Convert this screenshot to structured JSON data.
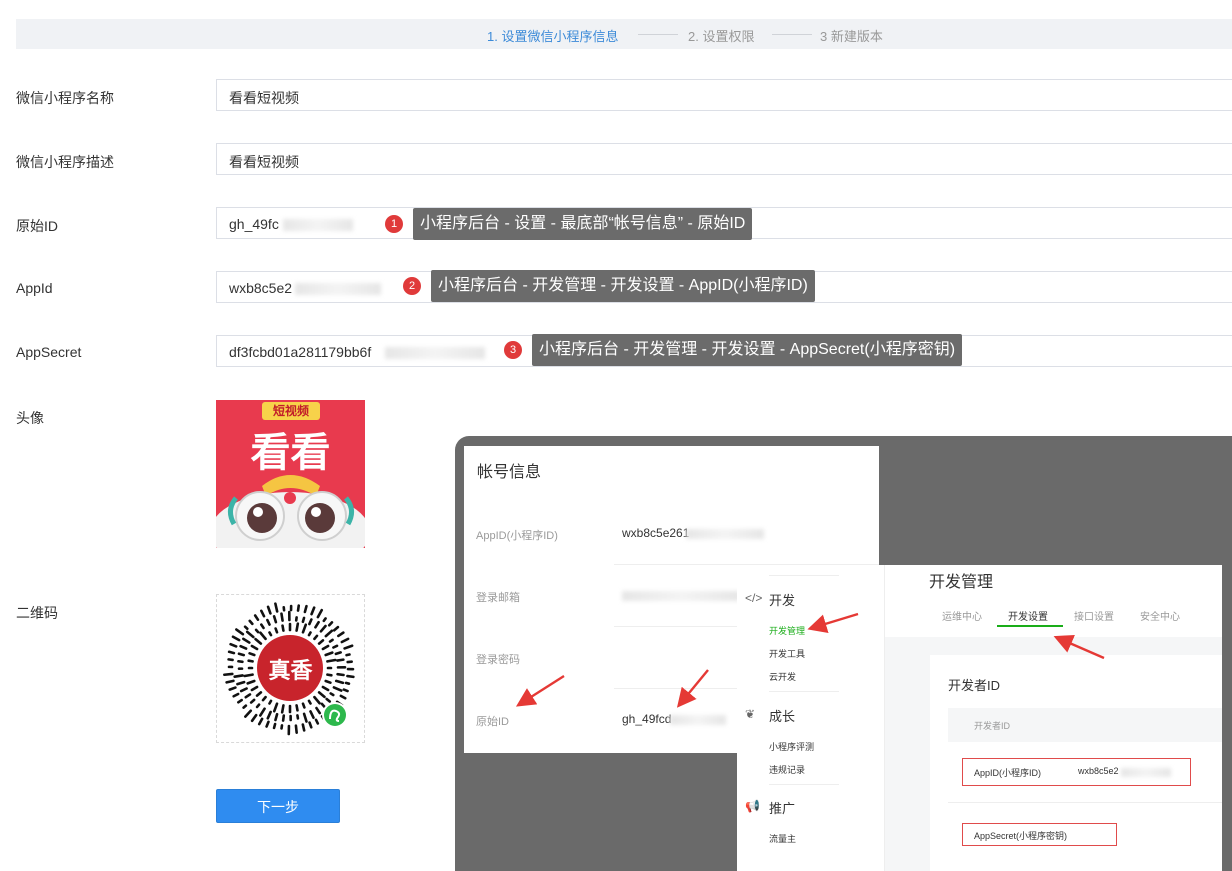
{
  "steps": [
    {
      "label": "1. 设置微信小程序信息",
      "active": true
    },
    {
      "label": "2. 设置权限",
      "active": false
    },
    {
      "label": "3 新建版本",
      "active": false
    }
  ],
  "form": {
    "name_label": "微信小程序名称",
    "name_value": "看看短视频",
    "desc_label": "微信小程序描述",
    "desc_value": "看看短视频",
    "origid_label": "原始ID",
    "origid_value": "gh_49fc",
    "appid_label": "AppId",
    "appid_value": "wxb8c5e2",
    "secret_label": "AppSecret",
    "secret_value": "df3fcbd01a281179bb6f",
    "avatar_label": "头像",
    "qr_label": "二维码",
    "next_label": "下一步"
  },
  "avatar": {
    "banner": "短视频",
    "text": "看看"
  },
  "qr": {
    "center_text": "真香"
  },
  "tips": [
    {
      "num": "1",
      "text": "小程序后台 - 设置 - 最底部“帐号信息” - 原始ID"
    },
    {
      "num": "2",
      "text": "小程序后台 - 开发管理 - 开发设置 - AppID(小程序ID)"
    },
    {
      "num": "3",
      "text": "小程序后台 - 开发管理 - 开发设置 - AppSecret(小程序密钥)"
    }
  ],
  "account": {
    "title": "帐号信息",
    "appid_label": "AppID(小程序ID)",
    "appid_value": "wxb8c5e261",
    "email_label": "登录邮箱",
    "password_label": "登录密码",
    "origid_label": "原始ID",
    "origid_value": "gh_49fcd"
  },
  "sidebar": {
    "group_dev": "开发",
    "item_dev_manage": "开发管理",
    "item_dev_tools": "开发工具",
    "item_cloud": "云开发",
    "group_growth": "成长",
    "item_review": "小程序评测",
    "item_violation": "违规记录",
    "group_promo": "推广",
    "item_traffic": "流量主"
  },
  "devmgmt": {
    "title": "开发管理",
    "tabs": [
      "运维中心",
      "开发设置",
      "接口设置",
      "安全中心"
    ],
    "section_title": "开发者ID",
    "th": "开发者ID",
    "appid_label": "AppID(小程序ID)",
    "appid_value": "wxb8c5e2",
    "secret_label": "AppSecret(小程序密钥)"
  },
  "colors": {
    "accent": "#2f8cf0",
    "badge": "#e03a3a",
    "tooltip": "#6b6b6b",
    "highlight_green": "#1aad19",
    "arrow": "#e53935"
  }
}
